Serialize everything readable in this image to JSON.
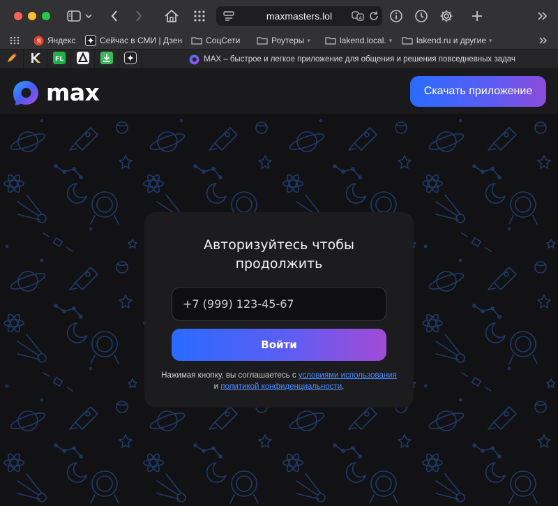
{
  "browser": {
    "address": "maxmasters.lol",
    "bookmarks": [
      {
        "label": "Яндекс"
      },
      {
        "label": "Сейчас в СМИ | Дзен"
      },
      {
        "label": "СоцСети"
      },
      {
        "label": "Роутеры"
      },
      {
        "label": "lakend.local."
      },
      {
        "label": "lakend.ru и другие"
      }
    ],
    "active_tab_title": "MAX – быстрое и легкое приложение для общения и решения повседневных задач"
  },
  "page": {
    "logo_text": "max",
    "download_label": "Скачать приложение",
    "login": {
      "title_line1": "Авторизуйтесь чтобы",
      "title_line2": "продолжить",
      "phone_placeholder": "+7 (999) 123-45-67",
      "submit_label": "Войти",
      "terms_prefix": "Нажимая кнопку, вы соглашаетесь с ",
      "terms_link1": "условиями использования",
      "terms_mid": " и ",
      "terms_link2": "политикой конфиденциальности",
      "terms_suffix": "."
    }
  },
  "colors": {
    "accent_start": "#2a6bff",
    "accent_end": "#a24bd6",
    "link": "#4d8cff",
    "pattern": "#1f3a6a"
  }
}
